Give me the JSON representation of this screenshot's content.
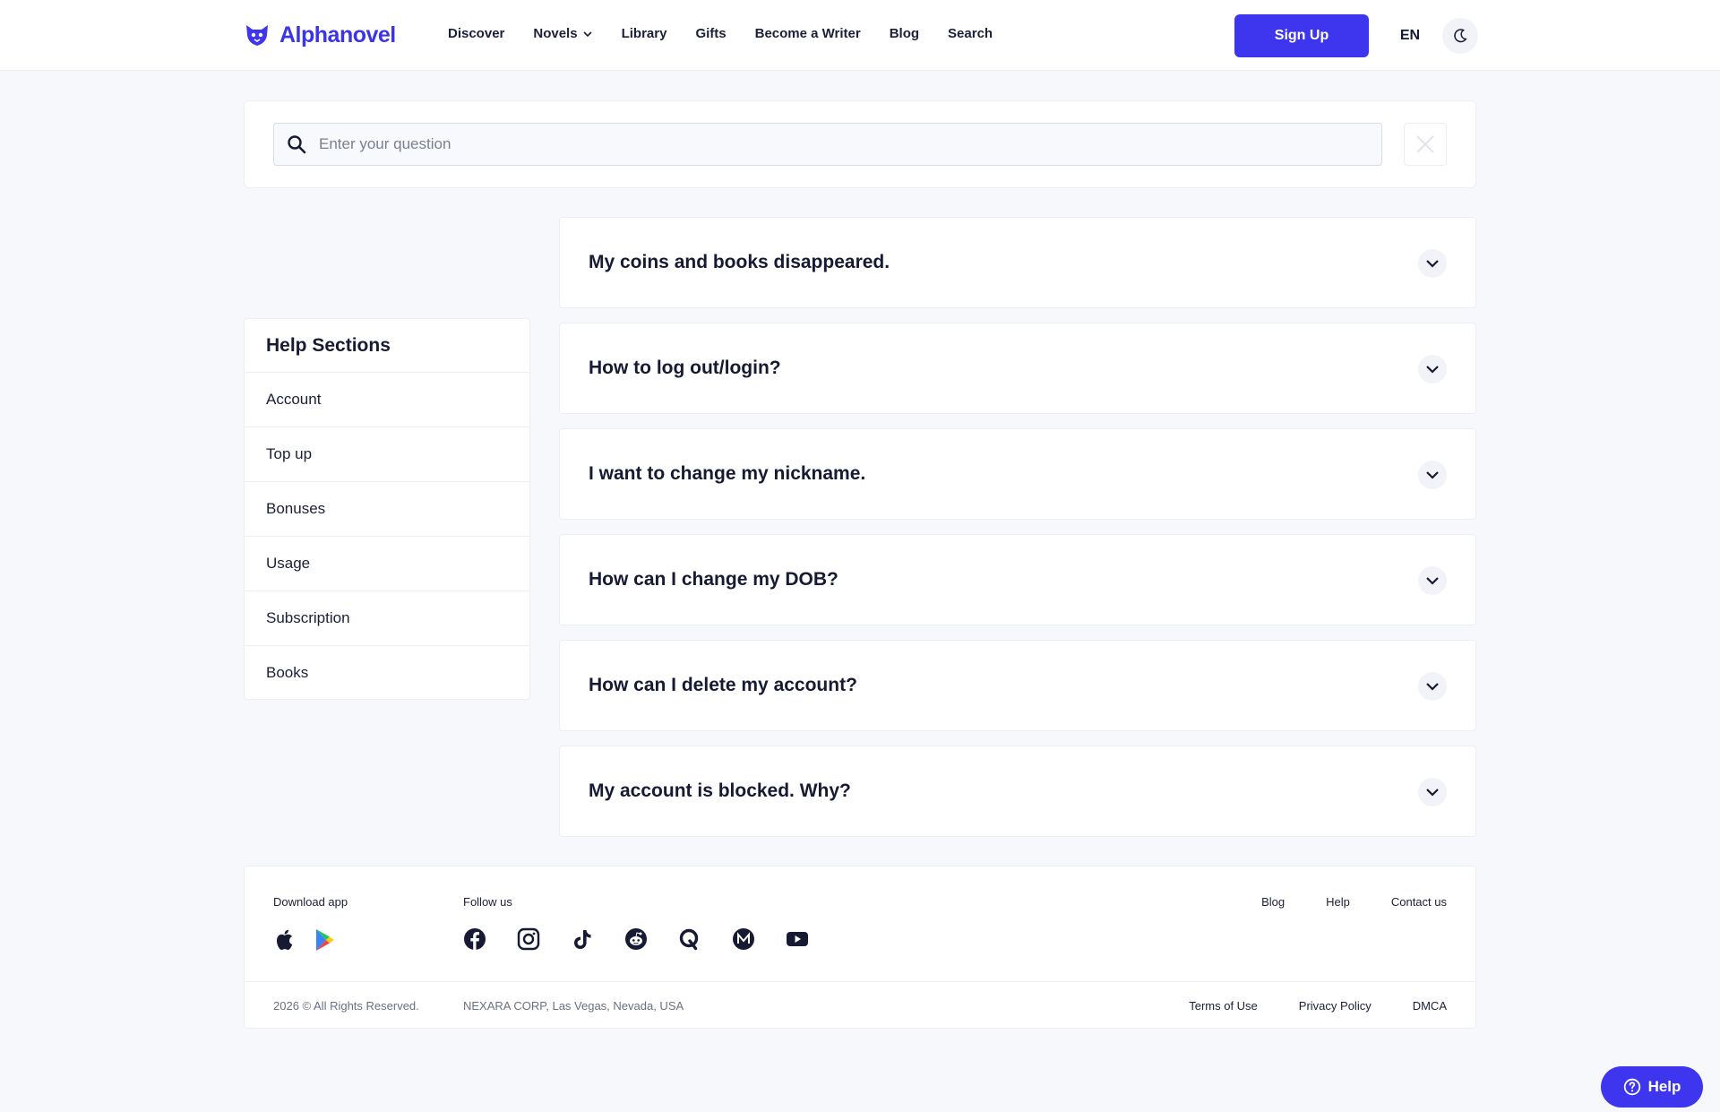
{
  "header": {
    "logo_text": "Alphanovel",
    "nav": [
      {
        "label": "Discover"
      },
      {
        "label": "Novels"
      },
      {
        "label": "Library"
      },
      {
        "label": "Gifts"
      },
      {
        "label": "Become a Writer"
      },
      {
        "label": "Blog"
      },
      {
        "label": "Search"
      }
    ],
    "signup_label": "Sign Up",
    "language": "EN",
    "theme_icon": "moon-icon"
  },
  "search": {
    "placeholder": "Enter your question",
    "value": ""
  },
  "help_sections": {
    "title": "Help Sections",
    "items": [
      {
        "label": "Account"
      },
      {
        "label": "Top up"
      },
      {
        "label": "Bonuses"
      },
      {
        "label": "Usage"
      },
      {
        "label": "Subscription"
      },
      {
        "label": "Books"
      }
    ]
  },
  "faq": [
    {
      "question": "My coins and books disappeared."
    },
    {
      "question": "How to log out/login?"
    },
    {
      "question": "I want to change my nickname."
    },
    {
      "question": "How can I change my DOB?"
    },
    {
      "question": "How can I delete my account?"
    },
    {
      "question": "My account is blocked. Why?"
    }
  ],
  "footer": {
    "download_label": "Download app",
    "follow_label": "Follow us",
    "app_icons": [
      "apple-icon",
      "google-play-icon"
    ],
    "social_icons": [
      "facebook-icon",
      "instagram-icon",
      "tiktok-icon",
      "reddit-icon",
      "quora-icon",
      "medium-icon",
      "youtube-icon"
    ],
    "links": [
      {
        "label": "Blog"
      },
      {
        "label": "Help"
      },
      {
        "label": "Contact us"
      }
    ],
    "copyright": "2026 © All Rights Reserved.",
    "address": "NEXARA CORP, Las Vegas, Nevada, USA",
    "legal": [
      {
        "label": "Terms of Use"
      },
      {
        "label": "Privacy Policy"
      },
      {
        "label": "DMCA"
      }
    ]
  },
  "help_button": {
    "label": "Help"
  },
  "colors": {
    "brand": "#3e36ee",
    "background": "#f7f8fc",
    "text": "#161a33"
  }
}
